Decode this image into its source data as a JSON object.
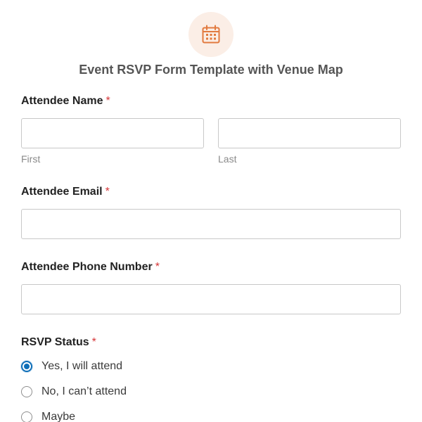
{
  "header": {
    "icon": "calendar-icon",
    "icon_color": "#e27a3f",
    "icon_bg": "#fbeee6",
    "title": "Event RSVP Form Template with Venue Map"
  },
  "fields": {
    "name": {
      "label": "Attendee Name",
      "required_mark": "*",
      "first_value": "",
      "first_sublabel": "First",
      "last_value": "",
      "last_sublabel": "Last"
    },
    "email": {
      "label": "Attendee Email",
      "required_mark": "*",
      "value": ""
    },
    "phone": {
      "label": "Attendee Phone Number",
      "required_mark": "*",
      "value": ""
    },
    "rsvp": {
      "label": "RSVP Status",
      "required_mark": "*",
      "options": [
        {
          "label": "Yes, I will attend",
          "selected": true
        },
        {
          "label": "No, I can’t attend",
          "selected": false
        },
        {
          "label": "Maybe",
          "selected": false
        }
      ]
    }
  },
  "colors": {
    "required": "#d63638",
    "accent": "#0f6fb8",
    "input_border": "#c8c8c8"
  }
}
